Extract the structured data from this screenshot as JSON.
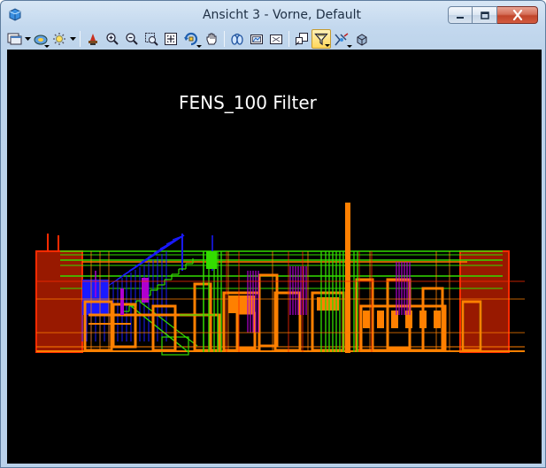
{
  "window": {
    "title": "Ansicht 3 - Vorne, Default",
    "minimize_icon": "minimize-icon",
    "maximize_icon": "maximize-icon",
    "close_icon": "close-icon"
  },
  "toolbar": {
    "tools": [
      "view-attributes-icon",
      "view-display-mode-icon",
      "lighting-icon",
      "update-view-icon",
      "zoom-in-icon",
      "zoom-out-icon",
      "window-area-icon",
      "fit-view-icon",
      "rotate-view-icon",
      "pan-view-icon",
      "view-previous-icon",
      "view-next-icon",
      "copy-view-icon",
      "clip-volume-icon",
      "view-filter-icon",
      "camera-icon",
      "render-icon"
    ],
    "selected_tool": "view-filter-icon"
  },
  "viewport": {
    "background": "#000000",
    "label": "FENS_100 Filter",
    "colors": {
      "red": "#ff2a00",
      "orange": "#ff8000",
      "green": "#33dd00",
      "blue": "#1a1aff",
      "magenta": "#b000d0"
    }
  }
}
